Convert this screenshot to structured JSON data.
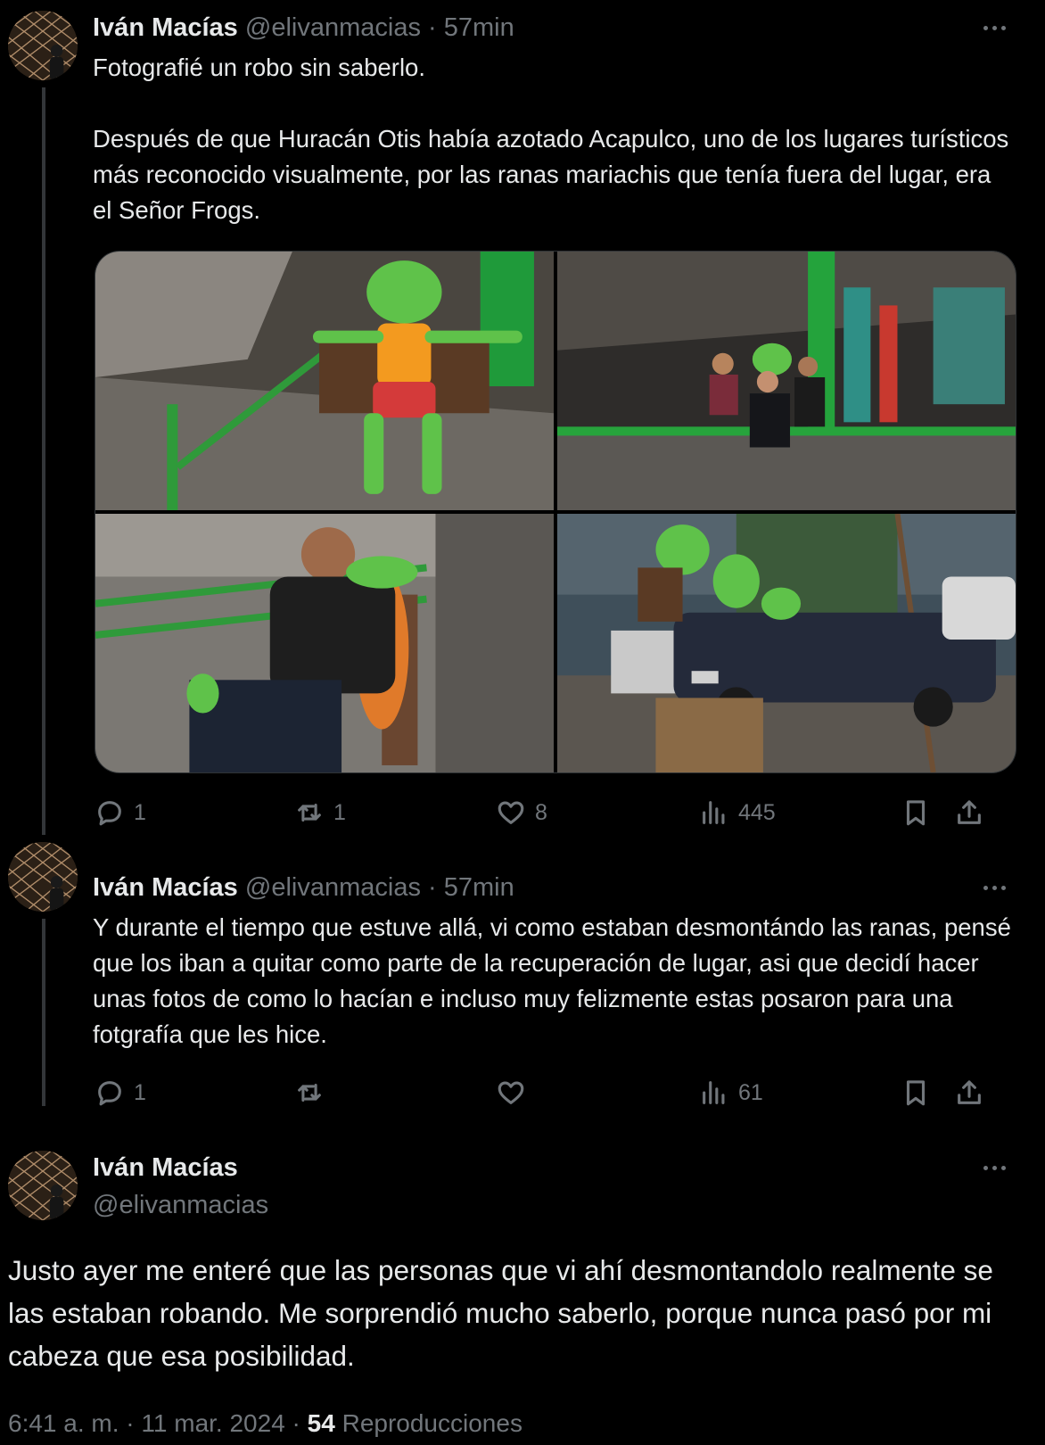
{
  "tweets": [
    {
      "name": "Iván Macías",
      "handle": "@elivanmacias",
      "time": "· 57min",
      "paragraphs": [
        "Fotografié un robo sin saberlo.",
        "Después de que Huracán Otis había azotado Acapulco, uno de los lugares turísticos más reconocido visualmente, por las ranas mariachis que tenía fuera del lugar, era el Señor Frogs."
      ],
      "replies": "1",
      "reposts": "1",
      "likes": "8",
      "views": "445"
    },
    {
      "name": "Iván Macías",
      "handle": "@elivanmacias",
      "time": "· 57min",
      "paragraphs": [
        "Y durante el tiempo que estuve allá, vi como estaban desmontándo las ranas, pensé que los iban a quitar como parte de la recuperación de lugar, asi que decidí hacer unas fotos de como lo hacían e incluso muy felizmente estas posaron para una fotgrafía que les hice."
      ],
      "replies": "1",
      "reposts": "",
      "likes": "",
      "views": "61"
    }
  ],
  "main": {
    "name": "Iván Macías",
    "handle": "@elivanmacias",
    "text": "Justo ayer me enteré que las personas que vi ahí desmontandolo realmente se las estaban robando. Me sorprendió mucho saberlo, porque nunca pasó por mi cabeza que esa posibilidad.",
    "timestamp": "6:41 a. m. · 11 mar. 2024 · ",
    "views_count": "54",
    "views_label": "Reproducciones"
  },
  "icons": {
    "reply": "reply-icon",
    "repost": "repost-icon",
    "like": "heart-icon",
    "views": "views-chart-icon",
    "bookmark": "bookmark-icon",
    "share": "share-icon",
    "more": "more-dots-icon"
  },
  "colors": {
    "background": "#000000",
    "text": "#e7e9ea",
    "secondary": "#71767b",
    "thread_line": "#333639",
    "frog_green": "#3da83a"
  }
}
